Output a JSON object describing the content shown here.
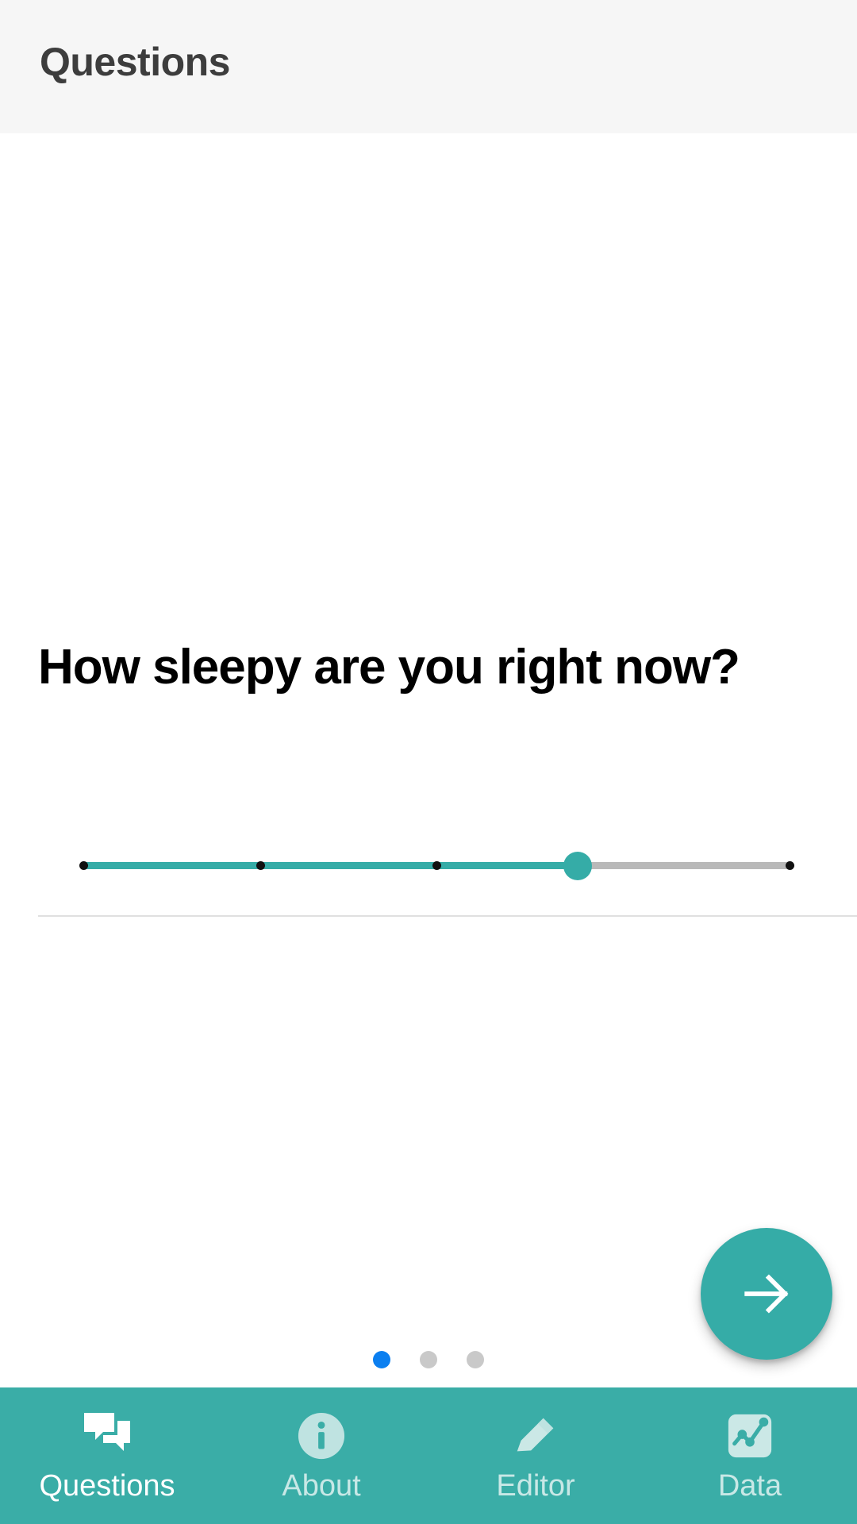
{
  "appbar": {
    "title": "Questions"
  },
  "main": {
    "question": "How sleepy are you right now?",
    "slider": {
      "name": "sleepiness-slider",
      "value": 70,
      "min": 0,
      "max": 100,
      "tick_positions": [
        0,
        25,
        50,
        100
      ],
      "fill_color": "#35aca7",
      "track_color": "#b9b9b9",
      "tick_color": "#111111"
    },
    "next_button": {
      "label": "Next",
      "icon": "arrow-right-icon",
      "color": "#35aca7"
    },
    "page_indicator": {
      "count": 3,
      "active_index": 0,
      "active_color": "#0b7ff0",
      "inactive_color": "#c9c9c9"
    }
  },
  "bottom_nav": {
    "background": "#3aada7",
    "active_index": 0,
    "items": [
      {
        "label": "Questions",
        "icon": "chat-bubbles-icon"
      },
      {
        "label": "About",
        "icon": "info-circle-icon"
      },
      {
        "label": "Editor",
        "icon": "pencil-icon"
      },
      {
        "label": "Data",
        "icon": "chart-square-icon"
      }
    ]
  }
}
